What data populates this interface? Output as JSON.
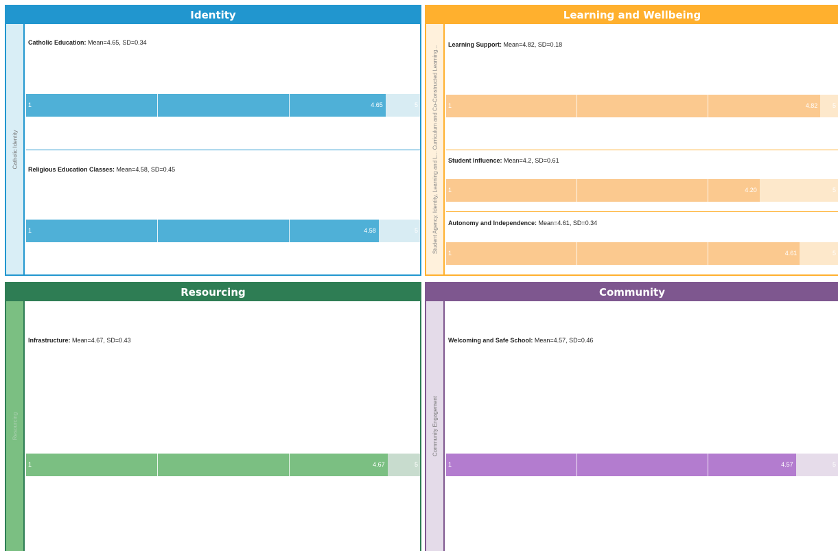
{
  "colors": {
    "identity": {
      "header": "#2196cf",
      "strip": "#d9eef6",
      "bar": "#4fb0d7",
      "track": "#d8ecf3",
      "border": "#2196cf",
      "divider": "#2196cf"
    },
    "learning": {
      "header": "#ffb02e",
      "strip": "#fff1dc",
      "bar": "#fbc98f",
      "track": "#fde8cb",
      "border": "#ffb02e",
      "divider": "#ffb02e"
    },
    "resourcing": {
      "header": "#2e7d54",
      "strip": "#7bbf82",
      "bar": "#7bbf82",
      "track": "#c8dcce",
      "border": "#2e7d54",
      "divider": "#2e7d54"
    },
    "community": {
      "header": "#7e578f",
      "strip": "#e4dbe9",
      "bar": "#b37ccf",
      "track": "#e6dcea",
      "border": "#7e578f",
      "divider": "#7e578f"
    }
  },
  "panels": {
    "identity": {
      "title": "Identity",
      "side_label": "Catholic Identity"
    },
    "learning": {
      "title": "Learning and Wellbeing",
      "side_label": "Student Agency, Identity, Learning and L... Curriculum and Co-Constructed Learning..."
    },
    "resourcing": {
      "title": "Resourcing",
      "side_label": "Resourcing"
    },
    "community": {
      "title": "Community",
      "side_label": "Community Engagement"
    }
  },
  "chart_data": [
    {
      "type": "bar",
      "title": "Identity",
      "xlim": [
        1,
        5
      ],
      "items": [
        {
          "name": "Catholic Education:",
          "stats": "Mean=4.65, SD=0.34",
          "mean": 4.65,
          "sd": 0.34,
          "label": "4.65",
          "min_label": "1",
          "max_label": "5"
        },
        {
          "name": "Religious Education Classes:",
          "stats": "Mean=4.58, SD=0.45",
          "mean": 4.58,
          "sd": 0.45,
          "label": "4.58",
          "min_label": "1",
          "max_label": "5"
        }
      ]
    },
    {
      "type": "bar",
      "title": "Learning and Wellbeing",
      "xlim": [
        1,
        5
      ],
      "items": [
        {
          "name": "Learning Support:",
          "stats": "Mean=4.82, SD=0.18",
          "mean": 4.82,
          "sd": 0.18,
          "label": "4.82",
          "min_label": "1",
          "max_label": "5"
        },
        {
          "name": "Student Influence:",
          "stats": "Mean=4.2, SD=0.61",
          "mean": 4.2,
          "sd": 0.61,
          "label": "4.20",
          "min_label": "1",
          "max_label": "5"
        },
        {
          "name": "Autonomy and Independence:",
          "stats": "Mean=4.61, SD=0.34",
          "mean": 4.61,
          "sd": 0.34,
          "label": "4.61",
          "min_label": "1",
          "max_label": "5"
        }
      ]
    },
    {
      "type": "bar",
      "title": "Resourcing",
      "xlim": [
        1,
        5
      ],
      "items": [
        {
          "name": "Infrastructure:",
          "stats": "Mean=4.67, SD=0.43",
          "mean": 4.67,
          "sd": 0.43,
          "label": "4.67",
          "min_label": "1",
          "max_label": "5"
        }
      ]
    },
    {
      "type": "bar",
      "title": "Community",
      "xlim": [
        1,
        5
      ],
      "items": [
        {
          "name": "Welcoming and Safe School:",
          "stats": "Mean=4.57, SD=0.46",
          "mean": 4.57,
          "sd": 0.46,
          "label": "4.57",
          "min_label": "1",
          "max_label": "5"
        }
      ]
    }
  ]
}
